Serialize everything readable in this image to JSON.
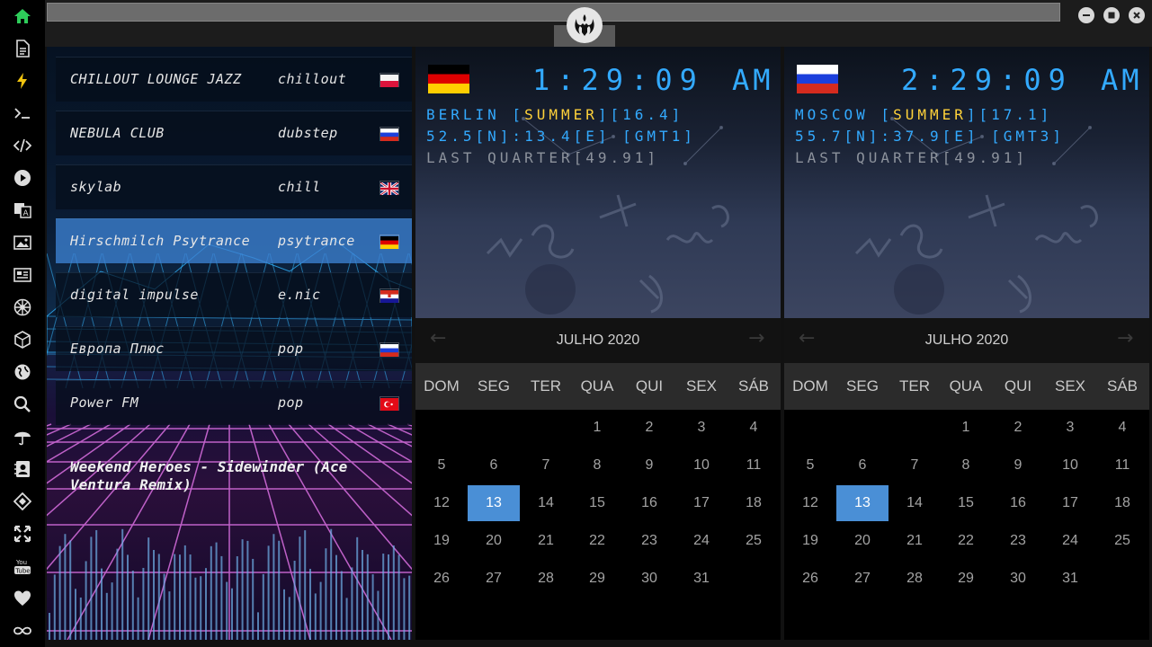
{
  "rail": {
    "icons": [
      "home-icon",
      "document-icon",
      "bolt-icon",
      "terminal-icon",
      "code-icon",
      "play-icon",
      "translate-icon",
      "image-icon",
      "news-icon",
      "empire-icon",
      "hexagon-icon",
      "globe-icon",
      "search-icon",
      "umbrella-icon",
      "contacts-icon",
      "tag-icon",
      "expand-icon",
      "youtube-icon",
      "heart-icon",
      "infinity-icon"
    ],
    "youtube_text": "You\nTube"
  },
  "stations": [
    {
      "name": "CHILLOUT LOUNGE JAZZ",
      "genre": "chillout",
      "flag": "poland"
    },
    {
      "name": "NEBULA CLUB",
      "genre": "dubstep",
      "flag": "russia"
    },
    {
      "name": "skylab",
      "genre": "chill",
      "flag": "uk"
    },
    {
      "name": "Hirschmilch Psytrance",
      "genre": "psytrance",
      "flag": "germany",
      "active": true
    },
    {
      "name": "digital impulse",
      "genre": "e.nic",
      "flag": "croatia"
    },
    {
      "name": "Европа Плюс",
      "genre": "pop",
      "flag": "russia"
    },
    {
      "name": "Power FM",
      "genre": "pop",
      "flag": "turkey"
    }
  ],
  "now_playing": "Weekend Heroes - Sidewinder (Ace Ventura Remix)",
  "clocks": [
    {
      "flag": "germany",
      "time": "1:29:09",
      "ampm": "AM",
      "city": "BERLIN",
      "season": "SUMMER",
      "temp": "16.4",
      "coords": "52.5[N]:13.4[E] [GMT1]",
      "moon": "LAST QUARTER[49.91]"
    },
    {
      "flag": "russia",
      "time": "2:29:09",
      "ampm": "AM",
      "city": "MOSCOW",
      "season": "SUMMER",
      "temp": "17.1",
      "coords": "55.7[N]:37.9[E] [GMT3]",
      "moon": "LAST QUARTER[49.91]"
    }
  ],
  "calendar": {
    "month_label": "JULHO 2020",
    "weekdays": [
      "DOM",
      "SEG",
      "TER",
      "QUA",
      "QUI",
      "SEX",
      "SÁB"
    ],
    "first_weekday_index": 3,
    "days_in_month": 31,
    "selected_day": 13,
    "prev_arrow": "←",
    "next_arrow": "→"
  },
  "colors": {
    "accent": "#33aaff",
    "highlight": "#ffd23a",
    "selected": "#4a8fd6",
    "active_station": "#3c82d2"
  }
}
